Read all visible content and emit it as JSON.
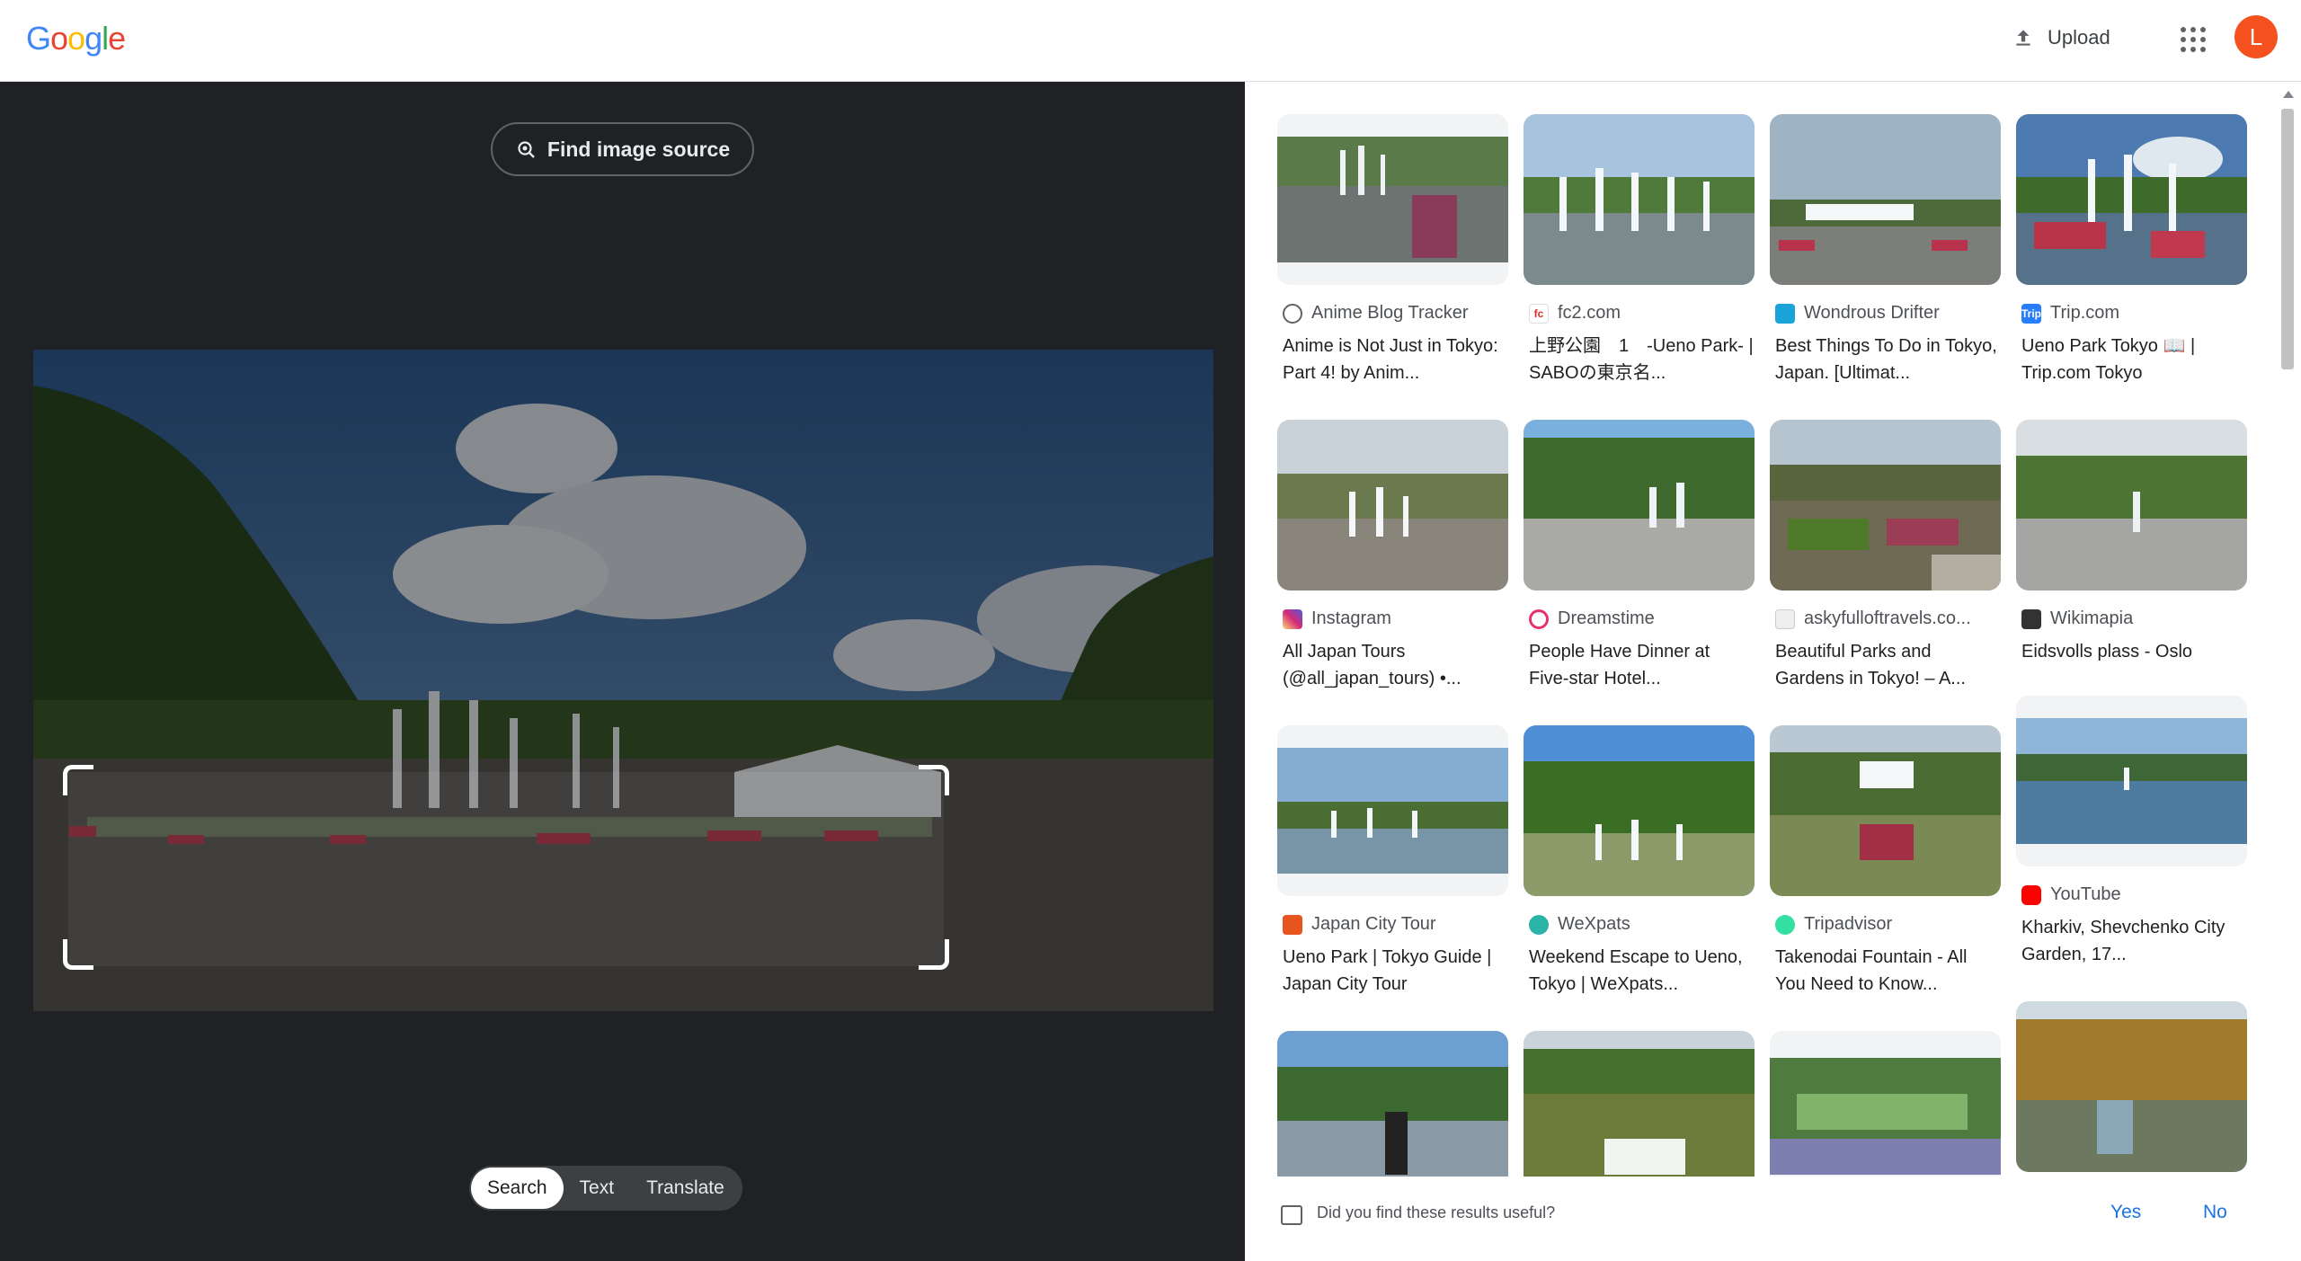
{
  "header": {
    "logo_text": "Google",
    "upload_label": "Upload",
    "avatar_letter": "L"
  },
  "left": {
    "find_source_label": "Find image source",
    "modes": [
      "Search",
      "Text",
      "Translate"
    ],
    "active_mode": "Search"
  },
  "results": [
    {
      "source": "Anime Blog Tracker",
      "title": "Anime is Not Just in Tokyo: Part 4! by Anim...",
      "icon": "globe-icon",
      "icon_color": "#5f6368"
    },
    {
      "source": "fc2.com",
      "title": "上野公園　1　-Ueno Park- | SABOの東京名...",
      "icon": "fc2-icon",
      "icon_color": "#d93025"
    },
    {
      "source": "Wondrous Drifter",
      "title": "Best Things To Do in Tokyo, Japan. [Ultimat...",
      "icon": "wondrous-drifter-icon",
      "icon_color": "#1aa3d9"
    },
    {
      "source": "Trip.com",
      "title": "Ueno Park Tokyo 📖 | Trip.com Tokyo",
      "icon": "trip-com-icon",
      "icon_color": "#287dfa"
    },
    {
      "source": "Instagram",
      "title": "All Japan Tours (@all_japan_tours) •...",
      "icon": "instagram-icon",
      "icon_color": "#d62976"
    },
    {
      "source": "Dreamstime",
      "title": "People Have Dinner at Five-star Hotel...",
      "icon": "dreamstime-icon",
      "icon_color": "#e5336d"
    },
    {
      "source": "askyfulloftravels.co...",
      "title": "Beautiful Parks and Gardens in Tokyo! – A...",
      "icon": "askyfulloftravels-icon",
      "icon_color": "#c7c7c7"
    },
    {
      "source": "Wikimapia",
      "title": "Eidsvolls plass - Oslo",
      "icon": "wikimapia-icon",
      "icon_color": "#333333"
    },
    {
      "source": "Japan City Tour",
      "title": "Ueno Park | Tokyo Guide | Japan City Tour",
      "icon": "japan-city-tour-icon",
      "icon_color": "#e8541e"
    },
    {
      "source": "WeXpats",
      "title": "Weekend Escape to Ueno, Tokyo | WeXpats...",
      "icon": "wexpats-icon",
      "icon_color": "#2ab3a6"
    },
    {
      "source": "Tripadvisor",
      "title": "Takenodai Fountain - All You Need to Know...",
      "icon": "tripadvisor-icon",
      "icon_color": "#34e0a1"
    },
    {
      "source": "YouTube",
      "title": "Kharkiv, Shevchenko City Garden, 17...",
      "icon": "youtube-icon",
      "icon_color": "#ff0000"
    }
  ],
  "feedback": {
    "question": "Did you find these results useful?",
    "yes": "Yes",
    "no": "No"
  }
}
